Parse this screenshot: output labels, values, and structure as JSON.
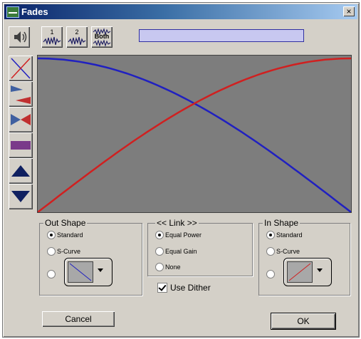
{
  "window": {
    "title": "Fades",
    "close_glyph": "×"
  },
  "toolbar": {
    "speaker_icon": "speaker-icon",
    "track1_label": "1",
    "track2_label": "2",
    "both_label": "Both",
    "progress_color": "#c8c8f0"
  },
  "shape_buttons": [
    "crossfade-x-icon",
    "fade-out-wedge-icon",
    "cross-wedge-icon",
    "flat-bar-icon",
    "up-triangle-icon",
    "down-triangle-icon"
  ],
  "graph": {
    "background": "#7d7d7d",
    "out_curve_color": "#2020c0",
    "in_curve_color": "#d02020"
  },
  "out_shape": {
    "legend": "Out Shape",
    "options": [
      {
        "label": "Standard",
        "selected": true
      },
      {
        "label": "S-Curve",
        "selected": false
      }
    ]
  },
  "link": {
    "legend": "<< Link >>",
    "options": [
      {
        "label": "Equal Power",
        "selected": true
      },
      {
        "label": "Equal Gain",
        "selected": false
      },
      {
        "label": "None",
        "selected": false
      }
    ]
  },
  "in_shape": {
    "legend": "In Shape",
    "options": [
      {
        "label": "Standard",
        "selected": true
      },
      {
        "label": "S-Curve",
        "selected": false
      }
    ]
  },
  "dither": {
    "label": "Use Dither",
    "checked": true
  },
  "buttons": {
    "cancel": "Cancel",
    "ok": "OK"
  }
}
